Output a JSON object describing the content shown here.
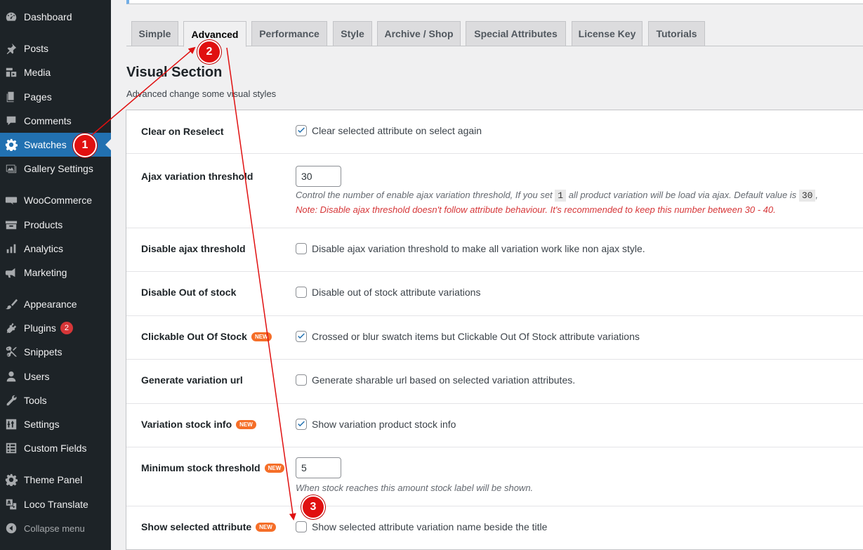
{
  "sidebar": {
    "items": [
      {
        "label": "Dashboard",
        "icon": "dashboard-icon"
      },
      {
        "label": "Posts",
        "icon": "pin-icon"
      },
      {
        "label": "Media",
        "icon": "media-icon"
      },
      {
        "label": "Pages",
        "icon": "pages-icon"
      },
      {
        "label": "Comments",
        "icon": "comment-icon"
      },
      {
        "label": "Swatches",
        "icon": "gear-icon",
        "active": true
      },
      {
        "label": "Gallery Settings",
        "icon": "gallery-icon"
      },
      {
        "label": "WooCommerce",
        "icon": "woo-icon"
      },
      {
        "label": "Products",
        "icon": "archive-icon"
      },
      {
        "label": "Analytics",
        "icon": "bar-chart-icon"
      },
      {
        "label": "Marketing",
        "icon": "megaphone-icon"
      },
      {
        "label": "Appearance",
        "icon": "brush-icon"
      },
      {
        "label": "Plugins",
        "icon": "plugin-icon",
        "badge": "2"
      },
      {
        "label": "Snippets",
        "icon": "scissors-icon"
      },
      {
        "label": "Users",
        "icon": "user-icon"
      },
      {
        "label": "Tools",
        "icon": "wrench-icon"
      },
      {
        "label": "Settings",
        "icon": "sliders-icon"
      },
      {
        "label": "Custom Fields",
        "icon": "grid-icon"
      },
      {
        "label": "Theme Panel",
        "icon": "gear-icon"
      },
      {
        "label": "Loco Translate",
        "icon": "translate-icon"
      },
      {
        "label": "Collapse menu",
        "icon": "collapse-icon"
      }
    ]
  },
  "tabs": [
    {
      "label": "Simple"
    },
    {
      "label": "Advanced",
      "active": true
    },
    {
      "label": "Performance"
    },
    {
      "label": "Style"
    },
    {
      "label": "Archive / Shop"
    },
    {
      "label": "Special Attributes"
    },
    {
      "label": "License Key"
    },
    {
      "label": "Tutorials"
    }
  ],
  "section": {
    "title": "Visual Section",
    "description": "Advanced change some visual styles"
  },
  "new_badge": "NEW",
  "settings": {
    "clear_on_reselect": {
      "label": "Clear on Reselect",
      "text": "Clear selected attribute on select again",
      "checked": true
    },
    "ajax_threshold": {
      "label": "Ajax variation threshold",
      "value": "30",
      "help_part1": "Control the number of enable ajax variation threshold, If you set",
      "help_code1": "1",
      "help_part2": "all product variation will be load via ajax. Default value is",
      "help_code2": "30",
      "help_part3": ",",
      "note": "Note: Disable ajax threshold doesn't follow attribute behaviour. It's recommended to keep this number between 30 - 40."
    },
    "disable_ajax_threshold": {
      "label": "Disable ajax threshold",
      "text": "Disable ajax variation threshold to make all variation work like non ajax style.",
      "checked": false
    },
    "disable_out_of_stock": {
      "label": "Disable Out of stock",
      "text": "Disable out of stock attribute variations",
      "checked": false
    },
    "clickable_out_of_stock": {
      "label": "Clickable Out Of Stock",
      "text": "Crossed or blur swatch items but Clickable Out Of Stock attribute variations",
      "checked": true
    },
    "generate_variation_url": {
      "label": "Generate variation url",
      "text": "Generate sharable url based on selected variation attributes.",
      "checked": false
    },
    "variation_stock_info": {
      "label": "Variation stock info",
      "text": "Show variation product stock info",
      "checked": true
    },
    "minimum_stock_threshold": {
      "label": "Minimum stock threshold",
      "value": "5",
      "help": "When stock reaches this amount stock label will be shown."
    },
    "show_selected_attribute": {
      "label": "Show selected attribute",
      "text": "Show selected attribute variation name beside the title",
      "checked": false
    }
  },
  "annotations": {
    "step1": "1",
    "step2": "2",
    "step3": "3",
    "color": "#e01010"
  }
}
